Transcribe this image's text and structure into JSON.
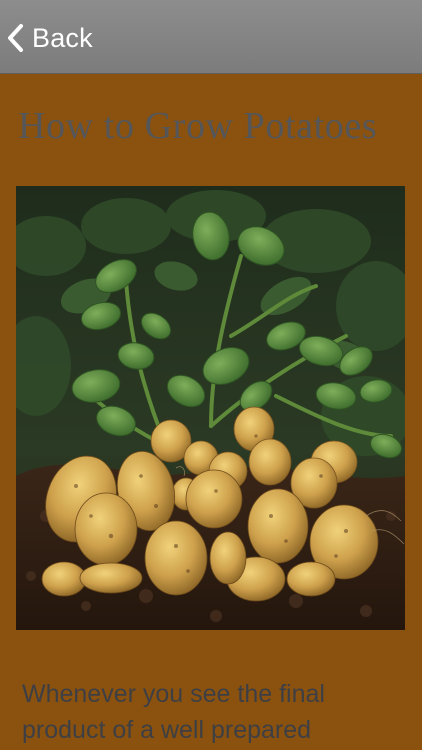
{
  "nav": {
    "back_label": "Back",
    "back_icon": "chevron-left-icon"
  },
  "article": {
    "title": "How to Grow Potatoes",
    "image_subject": "potato-plant-with-harvested-potatoes",
    "body": "Whenever you see the final product of a well prepared"
  },
  "colors": {
    "background": "#8a520e",
    "navbar": "#868686",
    "title_text": "#55565a",
    "body_text": "#3e3f44"
  }
}
